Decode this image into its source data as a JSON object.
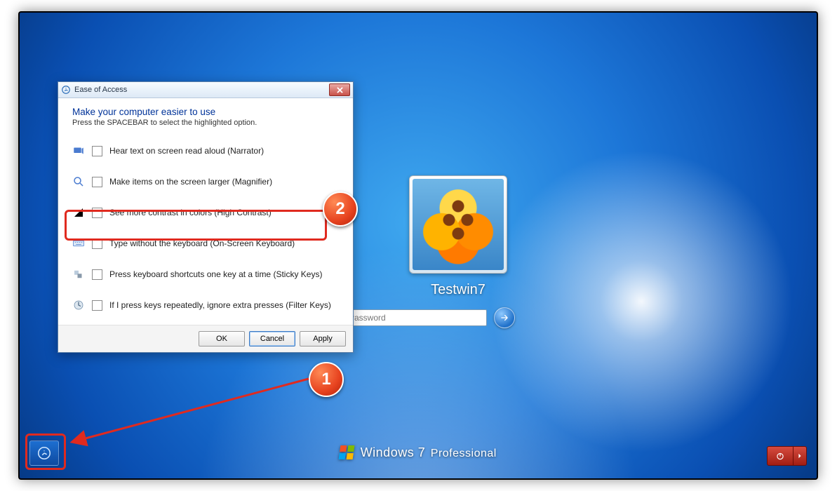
{
  "login": {
    "username": "Testwin7",
    "password_placeholder": "Password"
  },
  "branding": {
    "product": "Windows",
    "version": "7",
    "edition": "Professional"
  },
  "dialog": {
    "title": "Ease of Access",
    "heading": "Make your computer easier to use",
    "subtext": "Press the SPACEBAR to select the highlighted option.",
    "options": [
      {
        "label": "Hear text on screen read aloud (Narrator)"
      },
      {
        "label": "Make items on the screen larger (Magnifier)"
      },
      {
        "label": "See more contrast in colors (High Contrast)"
      },
      {
        "label": "Type without the keyboard (On-Screen Keyboard)"
      },
      {
        "label": "Press keyboard shortcuts one key at a time (Sticky Keys)"
      },
      {
        "label": "If I press keys repeatedly, ignore extra presses (Filter Keys)"
      }
    ],
    "buttons": {
      "ok": "OK",
      "cancel": "Cancel",
      "apply": "Apply"
    }
  },
  "annotations": {
    "badge1": "1",
    "badge2": "2"
  }
}
